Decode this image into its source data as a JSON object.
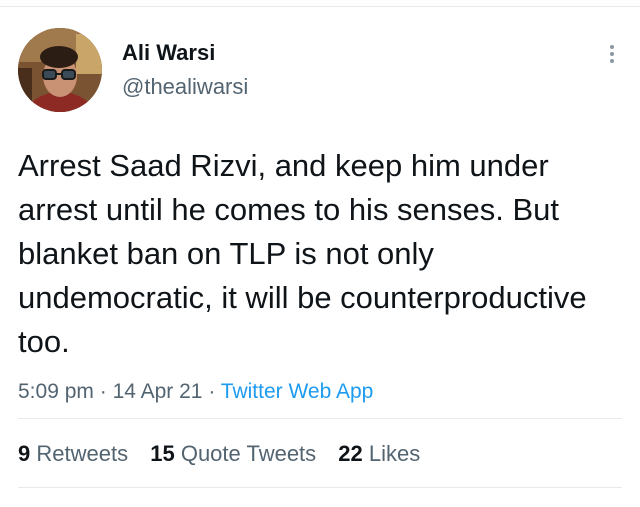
{
  "tweet": {
    "author": {
      "display_name": "Ali Warsi",
      "handle": "@thealiwarsi"
    },
    "text": "Arrest Saad Rizvi, and keep him under arrest until he comes to his senses. But blanket ban on TLP is not only undemocratic, it will be counterproductive too.",
    "time": "5:09 pm",
    "date": "14 Apr 21",
    "separator": "·",
    "source": "Twitter Web App",
    "stats": {
      "retweets": {
        "count": "9",
        "label": "Retweets"
      },
      "quote_tweets": {
        "count": "15",
        "label": "Quote Tweets"
      },
      "likes": {
        "count": "22",
        "label": "Likes"
      }
    }
  },
  "icons": {
    "more": "more-vertical-icon",
    "avatar": "avatar-photo"
  },
  "colors": {
    "text": "#0f1419",
    "secondary": "#536471",
    "link": "#1d9bf0",
    "divider": "#e7e9ea"
  }
}
